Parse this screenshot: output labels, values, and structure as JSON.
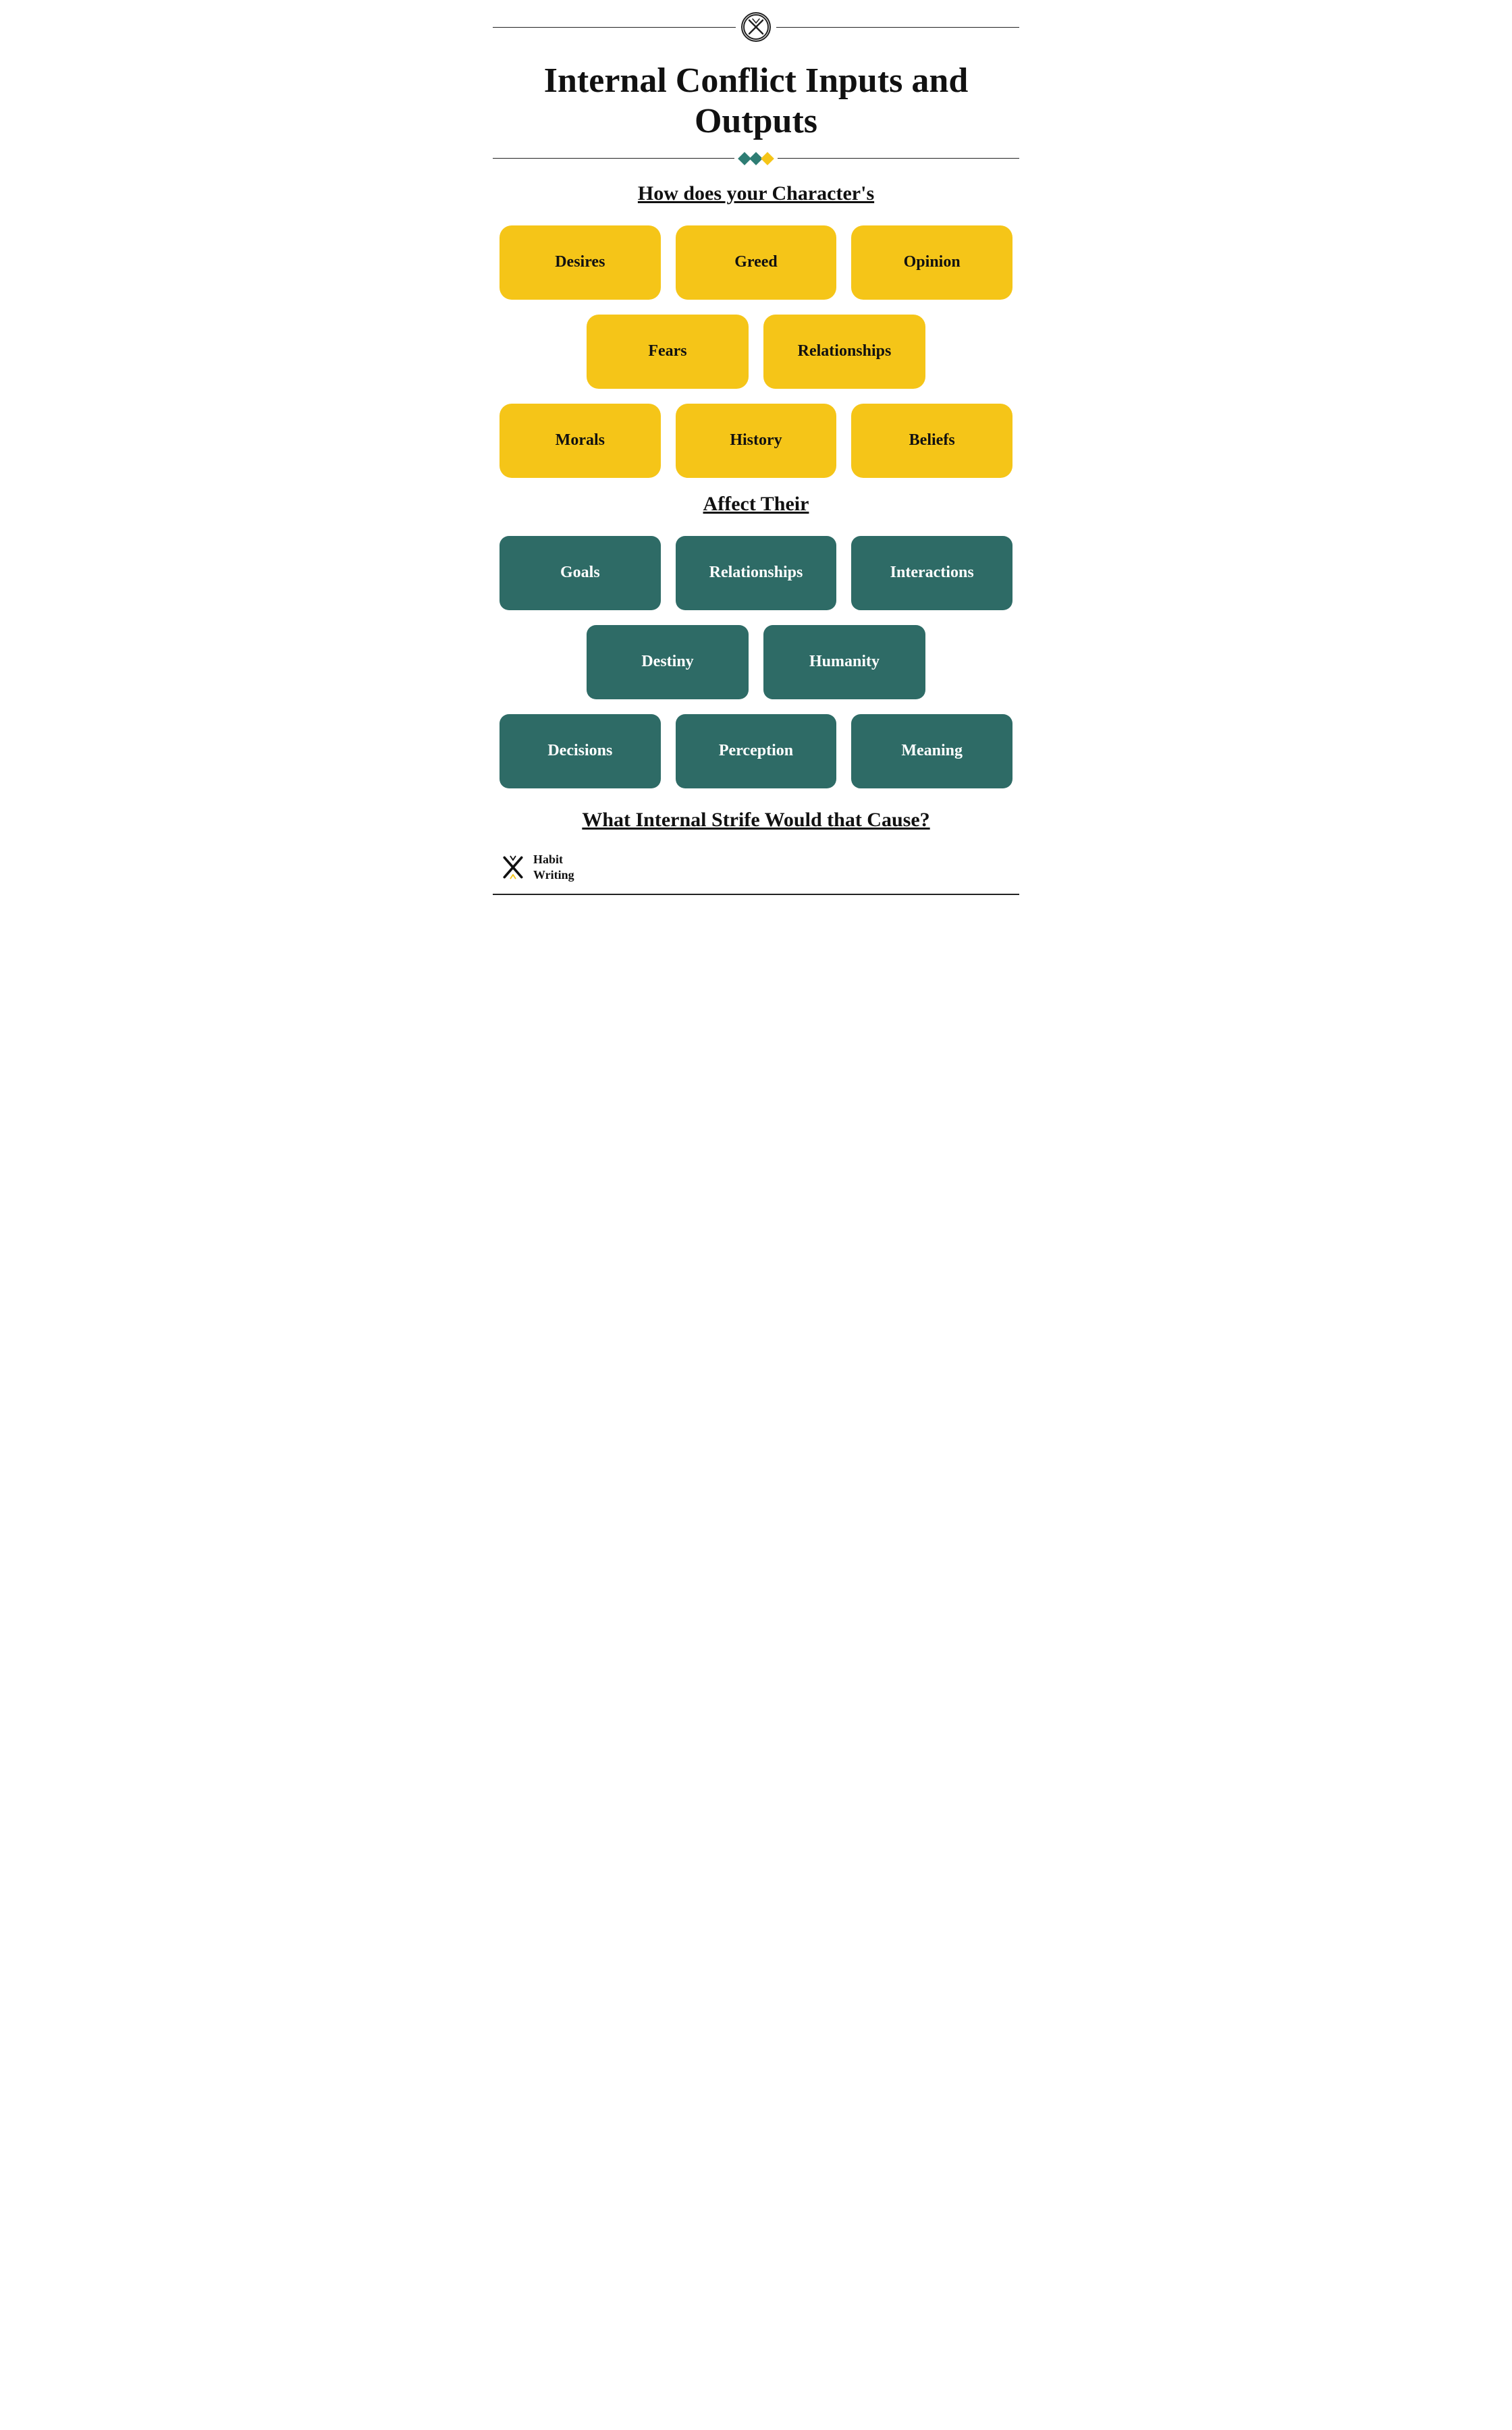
{
  "page": {
    "title": "Internal Conflict Inputs and Outputs",
    "subtitle_top": "How does your Character's",
    "subtitle_bottom": "Affect Their",
    "footer_question": "What Internal Strife Would that Cause?",
    "logo_text_line1": "Habit",
    "logo_text_line2": "Writing"
  },
  "yellow_boxes": {
    "row1": [
      "Desires",
      "Greed",
      "Opinion"
    ],
    "row2": [
      "Fears",
      "Relationships"
    ],
    "row3": [
      "Morals",
      "History",
      "Beliefs"
    ]
  },
  "teal_boxes": {
    "row1": [
      "Goals",
      "Relationships",
      "Interactions"
    ],
    "row2": [
      "Destiny",
      "Humanity"
    ],
    "row3": [
      "Decisions",
      "Perception",
      "Meaning"
    ]
  },
  "colors": {
    "yellow": "#f5c518",
    "teal": "#2e6b66",
    "accent_teal": "#2e7d74",
    "text_dark": "#111111",
    "white": "#ffffff"
  }
}
